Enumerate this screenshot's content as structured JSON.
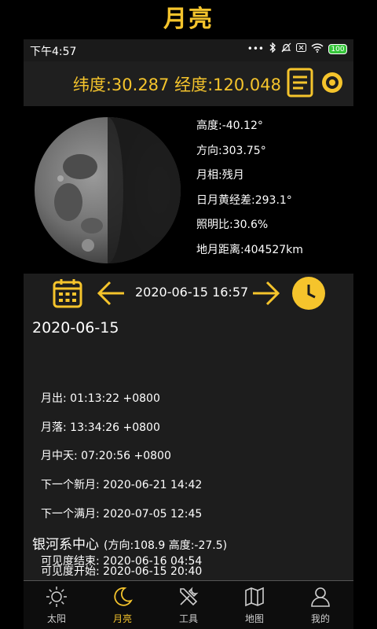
{
  "app": {
    "title": "月亮"
  },
  "status_bar": {
    "time": "下午4:57",
    "icons_text": "•••",
    "battery": "100"
  },
  "header": {
    "coords": "纬度:30.287 经度:120.048"
  },
  "moon": {
    "altitude": "高度:-40.12°",
    "direction": "方向:303.75°",
    "phase": "月相:残月",
    "elongation": "日月黄经差:293.1°",
    "illumination": "照明比:30.6%",
    "distance": "地月距离:404527km"
  },
  "nav": {
    "datetime": "2020-06-15 16:57"
  },
  "events": {
    "date": "2020-06-15",
    "moonrise": "月出: 01:13:22 +0800",
    "moonset": "月落: 13:34:26 +0800",
    "transit": "月中天: 07:20:56 +0800",
    "next_new": "下一个新月: 2020-06-21 14:42",
    "next_full": "下一个满月: 2020-07-05 12:45"
  },
  "galaxy": {
    "title": "银河系中心",
    "subtitle": "(方向:108.9 高度:-27.5)",
    "visible_start": "可见度开始: 2020-06-15 20:40",
    "visible_end": "可见度结束: 2020-06-16 04:54"
  },
  "tabs": [
    {
      "label": "太阳",
      "icon": "sun-icon"
    },
    {
      "label": "月亮",
      "icon": "moon-icon"
    },
    {
      "label": "工具",
      "icon": "tools-icon"
    },
    {
      "label": "地图",
      "icon": "map-icon"
    },
    {
      "label": "我的",
      "icon": "user-icon"
    }
  ],
  "colors": {
    "accent": "#f5c42c",
    "background": "#000000",
    "panel": "#1d1d1d"
  }
}
